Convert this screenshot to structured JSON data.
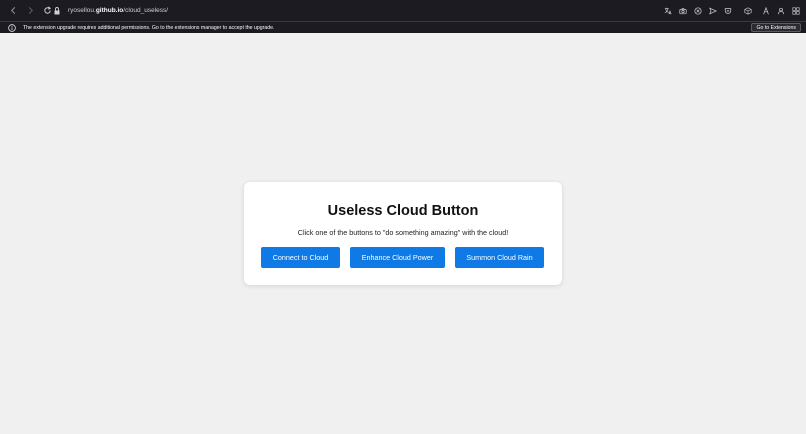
{
  "browser": {
    "url_prefix": "ryosellou.",
    "url_domain": "github.io",
    "url_path": "/cloud_useless/",
    "notice_text": "The extension upgrade requires additional permissions. Go to the extensions manager to accept the upgrade.",
    "notice_button": "Go to Extensions"
  },
  "card": {
    "title": "Useless Cloud Button",
    "subtitle": "Click one of the buttons to \"do something amazing\" with the cloud!",
    "buttons": [
      "Connect to Cloud",
      "Enhance Cloud Power",
      "Summon Cloud Rain"
    ]
  },
  "colors": {
    "button_bg": "#0f7ae5",
    "page_bg": "#f0f0f0",
    "toolbar_bg": "#1c1b22"
  }
}
